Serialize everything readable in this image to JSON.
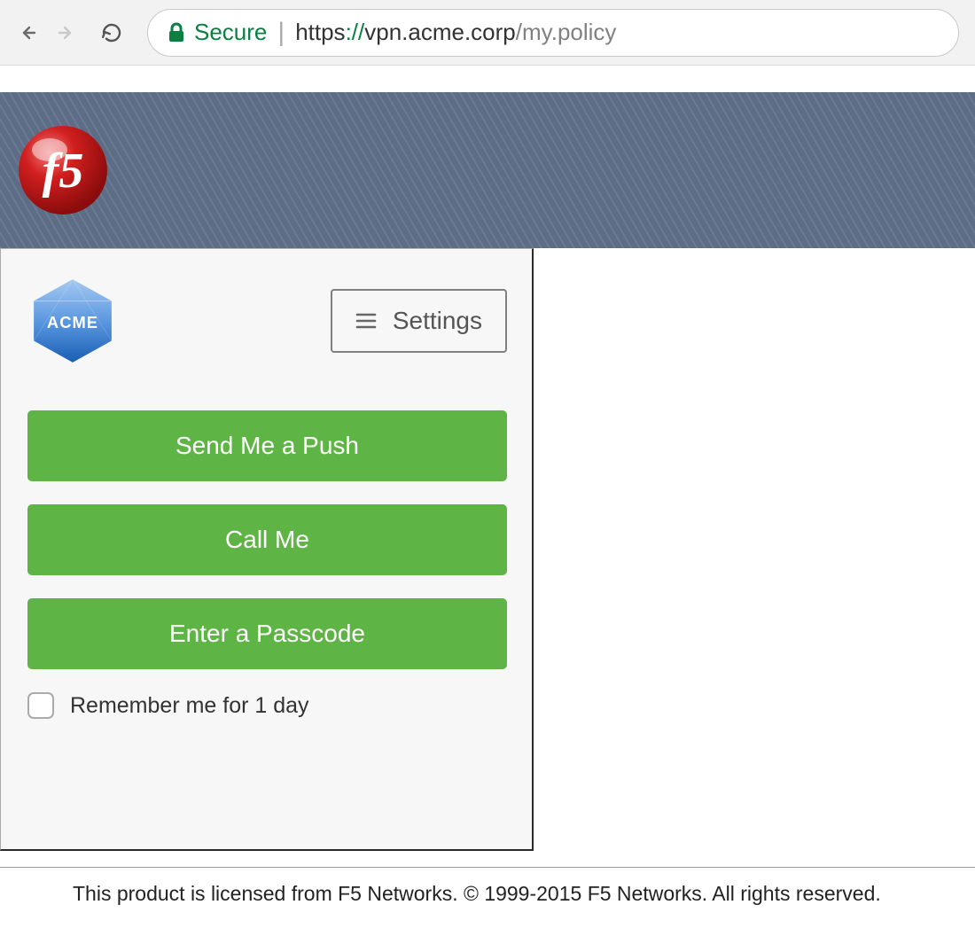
{
  "browser": {
    "secure_label": "Secure",
    "url_protocol": "https",
    "url_host": "vpn.acme.corp",
    "url_path": "/my.policy"
  },
  "brand": {
    "f5_logo_text": "f5",
    "acme_logo_text": "ACME"
  },
  "settings_button_label": "Settings",
  "actions": {
    "push_label": "Send Me a Push",
    "call_label": "Call Me",
    "passcode_label": "Enter a Passcode"
  },
  "remember": {
    "label": "Remember me for 1 day"
  },
  "footer_text": "This product is licensed from F5 Networks. © 1999-2015 F5 Networks. All rights reserved."
}
